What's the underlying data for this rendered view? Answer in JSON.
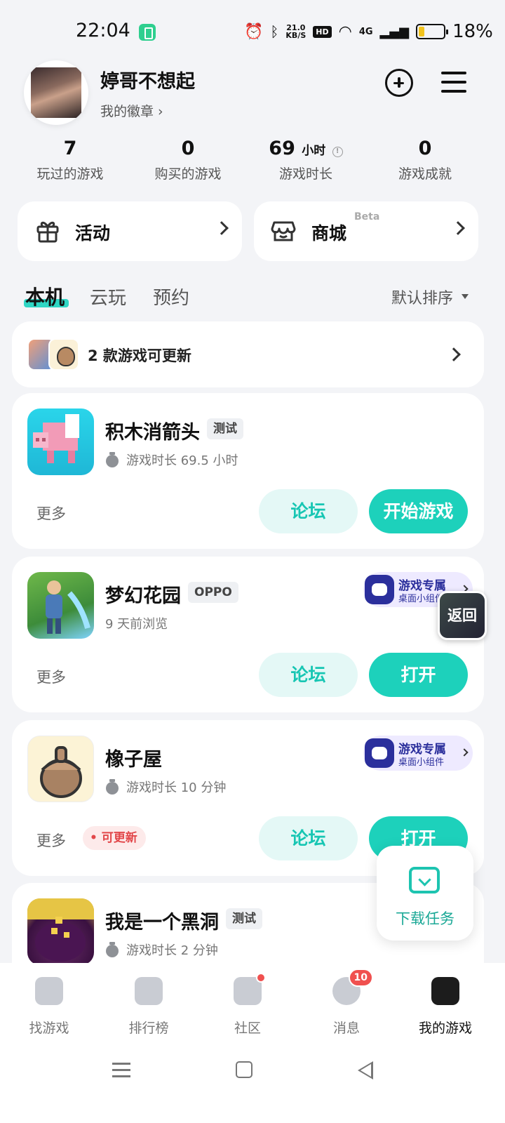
{
  "status_bar": {
    "time": "22:04",
    "net_speed": "21.0",
    "net_unit": "KB/S",
    "hd": "HD",
    "signal": "4G",
    "battery": "18%"
  },
  "profile": {
    "username": "婷哥不想起",
    "badge_link": "我的徽章 ›"
  },
  "stats": [
    {
      "value": "7",
      "unit": "",
      "label": "玩过的游戏"
    },
    {
      "value": "0",
      "unit": "",
      "label": "购买的游戏"
    },
    {
      "value": "69",
      "unit": "小时",
      "label": "游戏时长"
    },
    {
      "value": "0",
      "unit": "",
      "label": "游戏成就"
    }
  ],
  "quick_cards": {
    "activity": "活动",
    "store": "商城",
    "store_badge": "Beta"
  },
  "tabs": {
    "local": "本机",
    "cloud": "云玩",
    "reserve": "预约",
    "sort": "默认排序"
  },
  "update_bar": {
    "text": "2 款游戏可更新"
  },
  "games": [
    {
      "name": "积木消箭头",
      "tag": "测试",
      "sub": "游戏时长 69.5 小时",
      "more": "更多",
      "forum": "论坛",
      "action": "开始游戏"
    },
    {
      "name": "梦幻花园",
      "tag": "OPPO",
      "sub": "9 天前浏览",
      "more": "更多",
      "forum": "论坛",
      "action": "打开",
      "widget_title": "游戏专属",
      "widget_sub": "桌面小组件"
    },
    {
      "name": "橡子屋",
      "tag": "",
      "sub": "游戏时长 10 分钟",
      "more": "更多",
      "update_badge": "可更新",
      "forum": "论坛",
      "action": "打开",
      "widget_title": "游戏专属",
      "widget_sub": "桌面小组件"
    },
    {
      "name": "我是一个黑洞",
      "tag": "测试",
      "sub": "游戏时长 2 分钟"
    }
  ],
  "floating": {
    "back": "返回",
    "download": "下载任务"
  },
  "bottom_nav": [
    {
      "label": "找游戏"
    },
    {
      "label": "排行榜"
    },
    {
      "label": "社区"
    },
    {
      "label": "消息",
      "badge": "10"
    },
    {
      "label": "我的游戏"
    }
  ]
}
